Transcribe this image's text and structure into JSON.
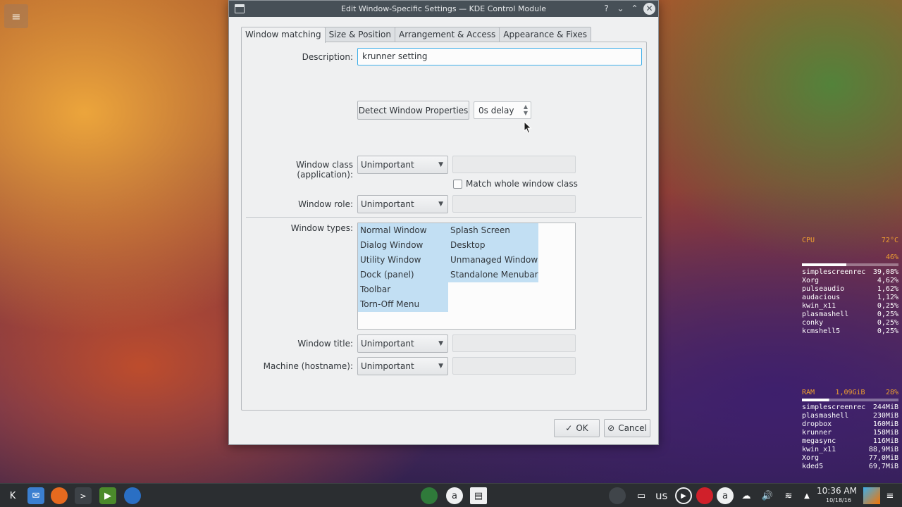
{
  "window": {
    "title": "Edit Window-Specific Settings — KDE Control Module",
    "help_btn": "?",
    "minimize_btn": "⌄",
    "maximize_btn": "⌃",
    "close_btn": "✕"
  },
  "tabs": [
    {
      "label": "Window matching",
      "active": true
    },
    {
      "label": "Size & Position",
      "active": false
    },
    {
      "label": "Arrangement & Access",
      "active": false
    },
    {
      "label": "Appearance & Fixes",
      "active": false
    }
  ],
  "form": {
    "description_label": "Description:",
    "description_value": "krunner setting",
    "detect_button": "Detect Window Properties",
    "delay_value": "0s delay",
    "window_class_label": "Window class (application):",
    "window_class_value": "Unimportant",
    "match_whole_class_label": "Match whole window class",
    "window_role_label": "Window role:",
    "window_role_value": "Unimportant",
    "window_types_label": "Window types:",
    "window_types_col1": [
      "Normal Window",
      "Dialog Window",
      "Utility Window",
      "Dock (panel)",
      "Toolbar",
      "Torn-Off Menu"
    ],
    "window_types_col2": [
      "Splash Screen",
      "Desktop",
      "Unmanaged Window",
      "Standalone Menubar"
    ],
    "window_title_label": "Window title:",
    "window_title_value": "Unimportant",
    "machine_label": "Machine (hostname):",
    "machine_value": "Unimportant"
  },
  "dialog_buttons": {
    "ok": "OK",
    "cancel": "Cancel"
  },
  "conky": {
    "cpu_label": "CPU",
    "cpu_temp": "72°C",
    "cpu_percent": "46%",
    "cpu_usage_fraction": 0.46,
    "cpu_processes": [
      {
        "name": "simplescreenrec",
        "value": "39,08%"
      },
      {
        "name": "Xorg",
        "value": "4,62%"
      },
      {
        "name": "pulseaudio",
        "value": "1,62%"
      },
      {
        "name": "audacious",
        "value": "1,12%"
      },
      {
        "name": "kwin_x11",
        "value": "0,25%"
      },
      {
        "name": "plasmashell",
        "value": "0,25%"
      },
      {
        "name": "conky",
        "value": "0,25%"
      },
      {
        "name": "kcmshell5",
        "value": "0,25%"
      }
    ],
    "ram_label": "RAM",
    "ram_used": "1,09GiB",
    "ram_percent": "28%",
    "ram_usage_fraction": 0.28,
    "ram_processes": [
      {
        "name": "simplescreenrec",
        "value": "244MiB"
      },
      {
        "name": "plasmashell",
        "value": "230MiB"
      },
      {
        "name": "dropbox",
        "value": "160MiB"
      },
      {
        "name": "krunner",
        "value": "158MiB"
      },
      {
        "name": "megasync",
        "value": "116MiB"
      },
      {
        "name": "kwin_x11",
        "value": "88,9MiB"
      },
      {
        "name": "Xorg",
        "value": "77,0MiB"
      },
      {
        "name": "kded5",
        "value": "69,7MiB"
      }
    ]
  },
  "taskbar": {
    "keyboard_layout": "us",
    "clock_time": "10:36 AM",
    "clock_date": "10/18/16"
  }
}
